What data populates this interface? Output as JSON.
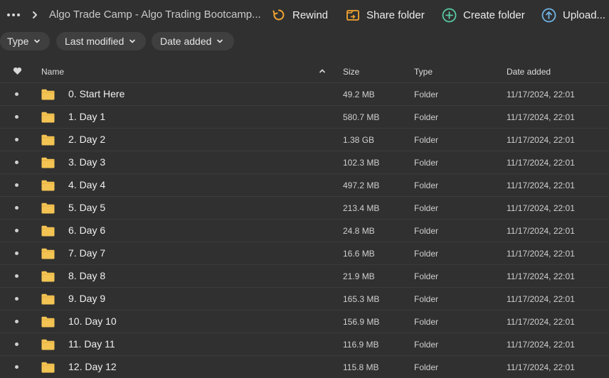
{
  "breadcrumb": {
    "current": "Algo Trade Camp - Algo Trading Bootcamp..."
  },
  "toolbar": {
    "rewind_label": "Rewind",
    "share_label": "Share folder",
    "create_label": "Create folder",
    "upload_label": "Upload..."
  },
  "filters": {
    "type_label": "Type",
    "modified_label": "Last modified",
    "added_label": "Date added"
  },
  "columns": {
    "name": "Name",
    "size": "Size",
    "type": "Type",
    "date": "Date added"
  },
  "colors": {
    "background": "#303030",
    "folder": "#f3c453",
    "rewind_accent": "#f2a531",
    "share_accent": "#f2a531",
    "create_accent": "#58c9a3",
    "upload_accent": "#6fb4e6"
  },
  "rows": [
    {
      "name": "0. Start Here",
      "size": "49.2 MB",
      "type": "Folder",
      "date": "11/17/2024, 22:01"
    },
    {
      "name": "1. Day 1",
      "size": "580.7 MB",
      "type": "Folder",
      "date": "11/17/2024, 22:01"
    },
    {
      "name": "2. Day 2",
      "size": "1.38 GB",
      "type": "Folder",
      "date": "11/17/2024, 22:01"
    },
    {
      "name": "3. Day 3",
      "size": "102.3 MB",
      "type": "Folder",
      "date": "11/17/2024, 22:01"
    },
    {
      "name": "4. Day 4",
      "size": "497.2 MB",
      "type": "Folder",
      "date": "11/17/2024, 22:01"
    },
    {
      "name": "5. Day 5",
      "size": "213.4 MB",
      "type": "Folder",
      "date": "11/17/2024, 22:01"
    },
    {
      "name": "6. Day 6",
      "size": "24.8 MB",
      "type": "Folder",
      "date": "11/17/2024, 22:01"
    },
    {
      "name": "7. Day 7",
      "size": "16.6 MB",
      "type": "Folder",
      "date": "11/17/2024, 22:01"
    },
    {
      "name": "8. Day 8",
      "size": "21.9 MB",
      "type": "Folder",
      "date": "11/17/2024, 22:01"
    },
    {
      "name": "9. Day 9",
      "size": "165.3 MB",
      "type": "Folder",
      "date": "11/17/2024, 22:01"
    },
    {
      "name": "10. Day 10",
      "size": "156.9 MB",
      "type": "Folder",
      "date": "11/17/2024, 22:01"
    },
    {
      "name": "11. Day 11",
      "size": "116.9 MB",
      "type": "Folder",
      "date": "11/17/2024, 22:01"
    },
    {
      "name": "12. Day 12",
      "size": "115.8 MB",
      "type": "Folder",
      "date": "11/17/2024, 22:01"
    }
  ]
}
